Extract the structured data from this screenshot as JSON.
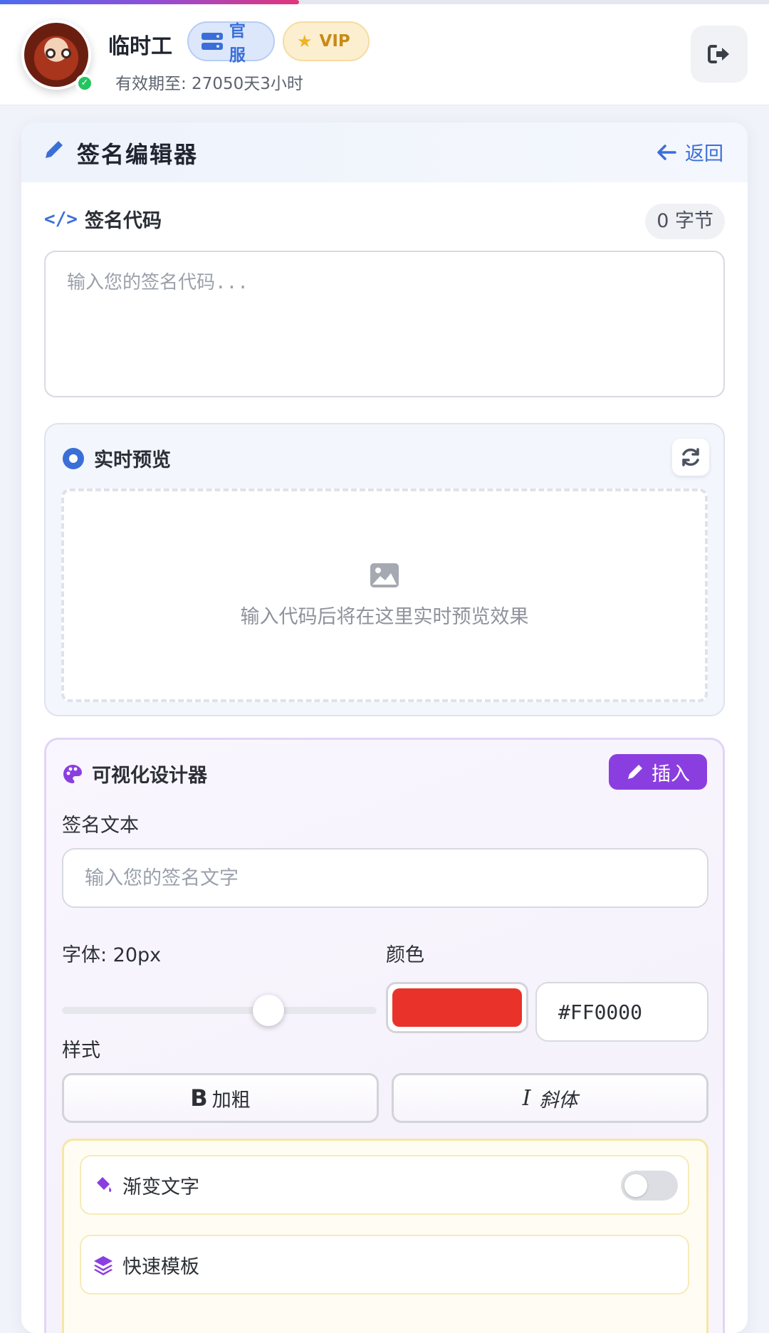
{
  "progress": {
    "fraction": 0.33
  },
  "header": {
    "username": "临时工",
    "badge_official": "官服",
    "badge_vip": "VIP",
    "expiry": "有效期至: 27050天3小时",
    "avatar_icon": "avatar",
    "logout_icon": "logout-icon"
  },
  "editor": {
    "title": "签名编辑器",
    "back_label": "返回",
    "code_label": "签名代码",
    "byte_count": "0 字节",
    "code_placeholder": "输入您的签名代码..."
  },
  "preview": {
    "title": "实时预览",
    "empty_text": "输入代码后将在这里实时预览效果"
  },
  "designer": {
    "title": "可视化设计器",
    "insert_label": "插入",
    "text_label": "签名文本",
    "text_placeholder": "输入您的签名文字",
    "font_label": "字体: 20px",
    "font_size_value": 20,
    "color_label": "颜色",
    "color_value": "#FF0000",
    "swatch_color": "#e9332a",
    "style_label": "样式",
    "bold_label": "加粗",
    "italic_label": "斜体",
    "gradient_label": "渐变文字",
    "gradient_enabled": false,
    "template_label": "快速模板"
  },
  "colors": {
    "accent_blue": "#3b6fd8",
    "accent_purple": "#8b3ee0",
    "vip_gold": "#c98a16"
  }
}
